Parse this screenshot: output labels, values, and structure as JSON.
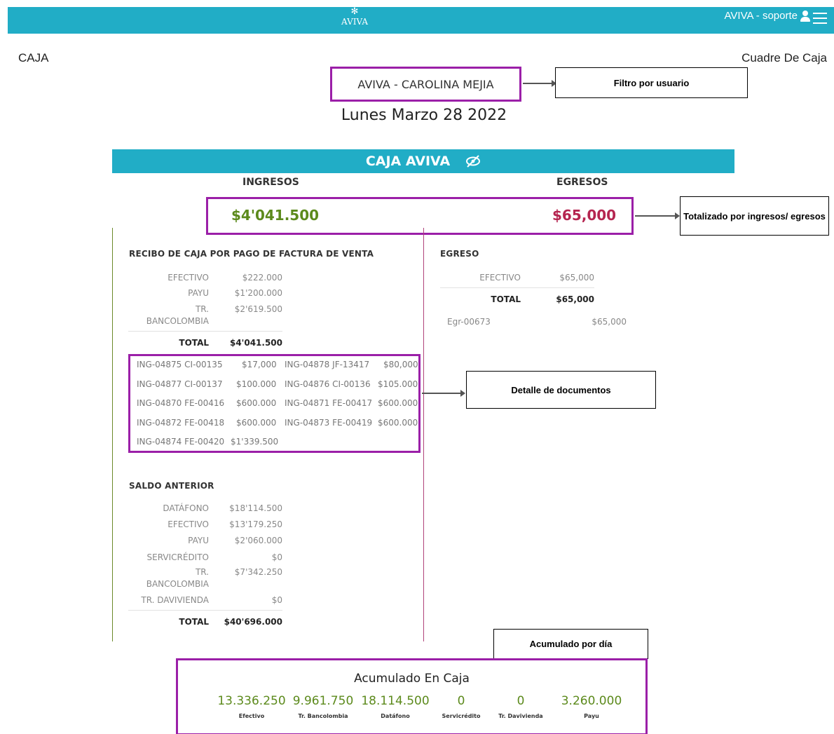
{
  "header": {
    "brand": "AVIVA",
    "user_label": "AVIVA - soporte"
  },
  "page": {
    "left_title": "CAJA",
    "right_title": "Cuadre De Caja",
    "user_filter": "AVIVA - CAROLINA MEJIA",
    "date": "Lunes Marzo 28 2022"
  },
  "callouts": {
    "filtro": "Filtro por usuario",
    "totalizado": "Totalizado por ingresos/ egresos",
    "detalle": "Detalle de documentos",
    "acumulado": "Acumulado por día"
  },
  "caja": {
    "title": "CAJA AVIVA",
    "ingresos_header": "INGRESOS",
    "egresos_header": "EGRESOS",
    "total_ingresos": "$4'041.500",
    "total_egresos": "$65,000"
  },
  "recibo": {
    "title": "RECIBO DE CAJA POR PAGO DE FACTURA DE VENTA",
    "rows": [
      {
        "label": "EFECTIVO",
        "value": "$222.000"
      },
      {
        "label": "PAYU",
        "value": "$1'200.000"
      },
      {
        "label_line1": "TR.",
        "label_line2": "BANCOLOMBIA",
        "value": "$2'619.500"
      }
    ],
    "total_label": "TOTAL",
    "total_value": "$4'041.500"
  },
  "documents": [
    {
      "id": "ING-04875",
      "ref": "CI-00135",
      "value": "$17,000"
    },
    {
      "id": "ING-04878",
      "ref": "JF-13417",
      "value": "$80,000"
    },
    {
      "id": "ING-04877",
      "ref": "CI-00137",
      "value": "$100.000"
    },
    {
      "id": "ING-04876",
      "ref": "CI-00136",
      "value": "$105.000"
    },
    {
      "id": "ING-04870",
      "ref": "FE-00416",
      "value": "$600.000"
    },
    {
      "id": "ING-04871",
      "ref": "FE-00417",
      "value": "$600.000"
    },
    {
      "id": "ING-04872",
      "ref": "FE-00418",
      "value": "$600.000"
    },
    {
      "id": "ING-04873",
      "ref": "FE-00419",
      "value": "$600.000"
    },
    {
      "id": "ING-04874",
      "ref": "FE-00420",
      "value": "$1'339.500"
    }
  ],
  "saldo": {
    "title": "SALDO ANTERIOR",
    "rows": [
      {
        "label": "DATÁFONO",
        "value": "$18'114.500"
      },
      {
        "label": "EFECTIVO",
        "value": "$13'179.250"
      },
      {
        "label": "PAYU",
        "value": "$2'060.000"
      },
      {
        "label": "SERVICRÉDITO",
        "value": "$0"
      },
      {
        "label_line1": "TR.",
        "label_line2": "BANCOLOMBIA",
        "value": "$7'342.250"
      },
      {
        "label": "TR. DAVIVIENDA",
        "value": "$0"
      }
    ],
    "total_label": "TOTAL",
    "total_value": "$40'696.000"
  },
  "egreso": {
    "title": "EGRESO",
    "rows": [
      {
        "label": "EFECTIVO",
        "value": "$65,000"
      }
    ],
    "total_label": "TOTAL",
    "total_value": "$65,000",
    "doc_id": "Egr-00673",
    "doc_value": "$65,000"
  },
  "acumulado": {
    "title": "Acumulado En Caja",
    "items": [
      {
        "value": "13.336.250",
        "label": "Efectivo"
      },
      {
        "value": "9.961.750",
        "label": "Tr. Bancolombia"
      },
      {
        "value": "18.114.500",
        "label": "Datáfono"
      },
      {
        "value": "0",
        "label": "Servicrédito"
      },
      {
        "value": "0",
        "label": "Tr. Davivienda"
      },
      {
        "value": "3.260.000",
        "label": "Payu"
      }
    ]
  },
  "colors": {
    "brand": "#21adc6",
    "highlight": "#9b1fa8",
    "positive": "#5c8a1c",
    "negative": "#b52550"
  }
}
